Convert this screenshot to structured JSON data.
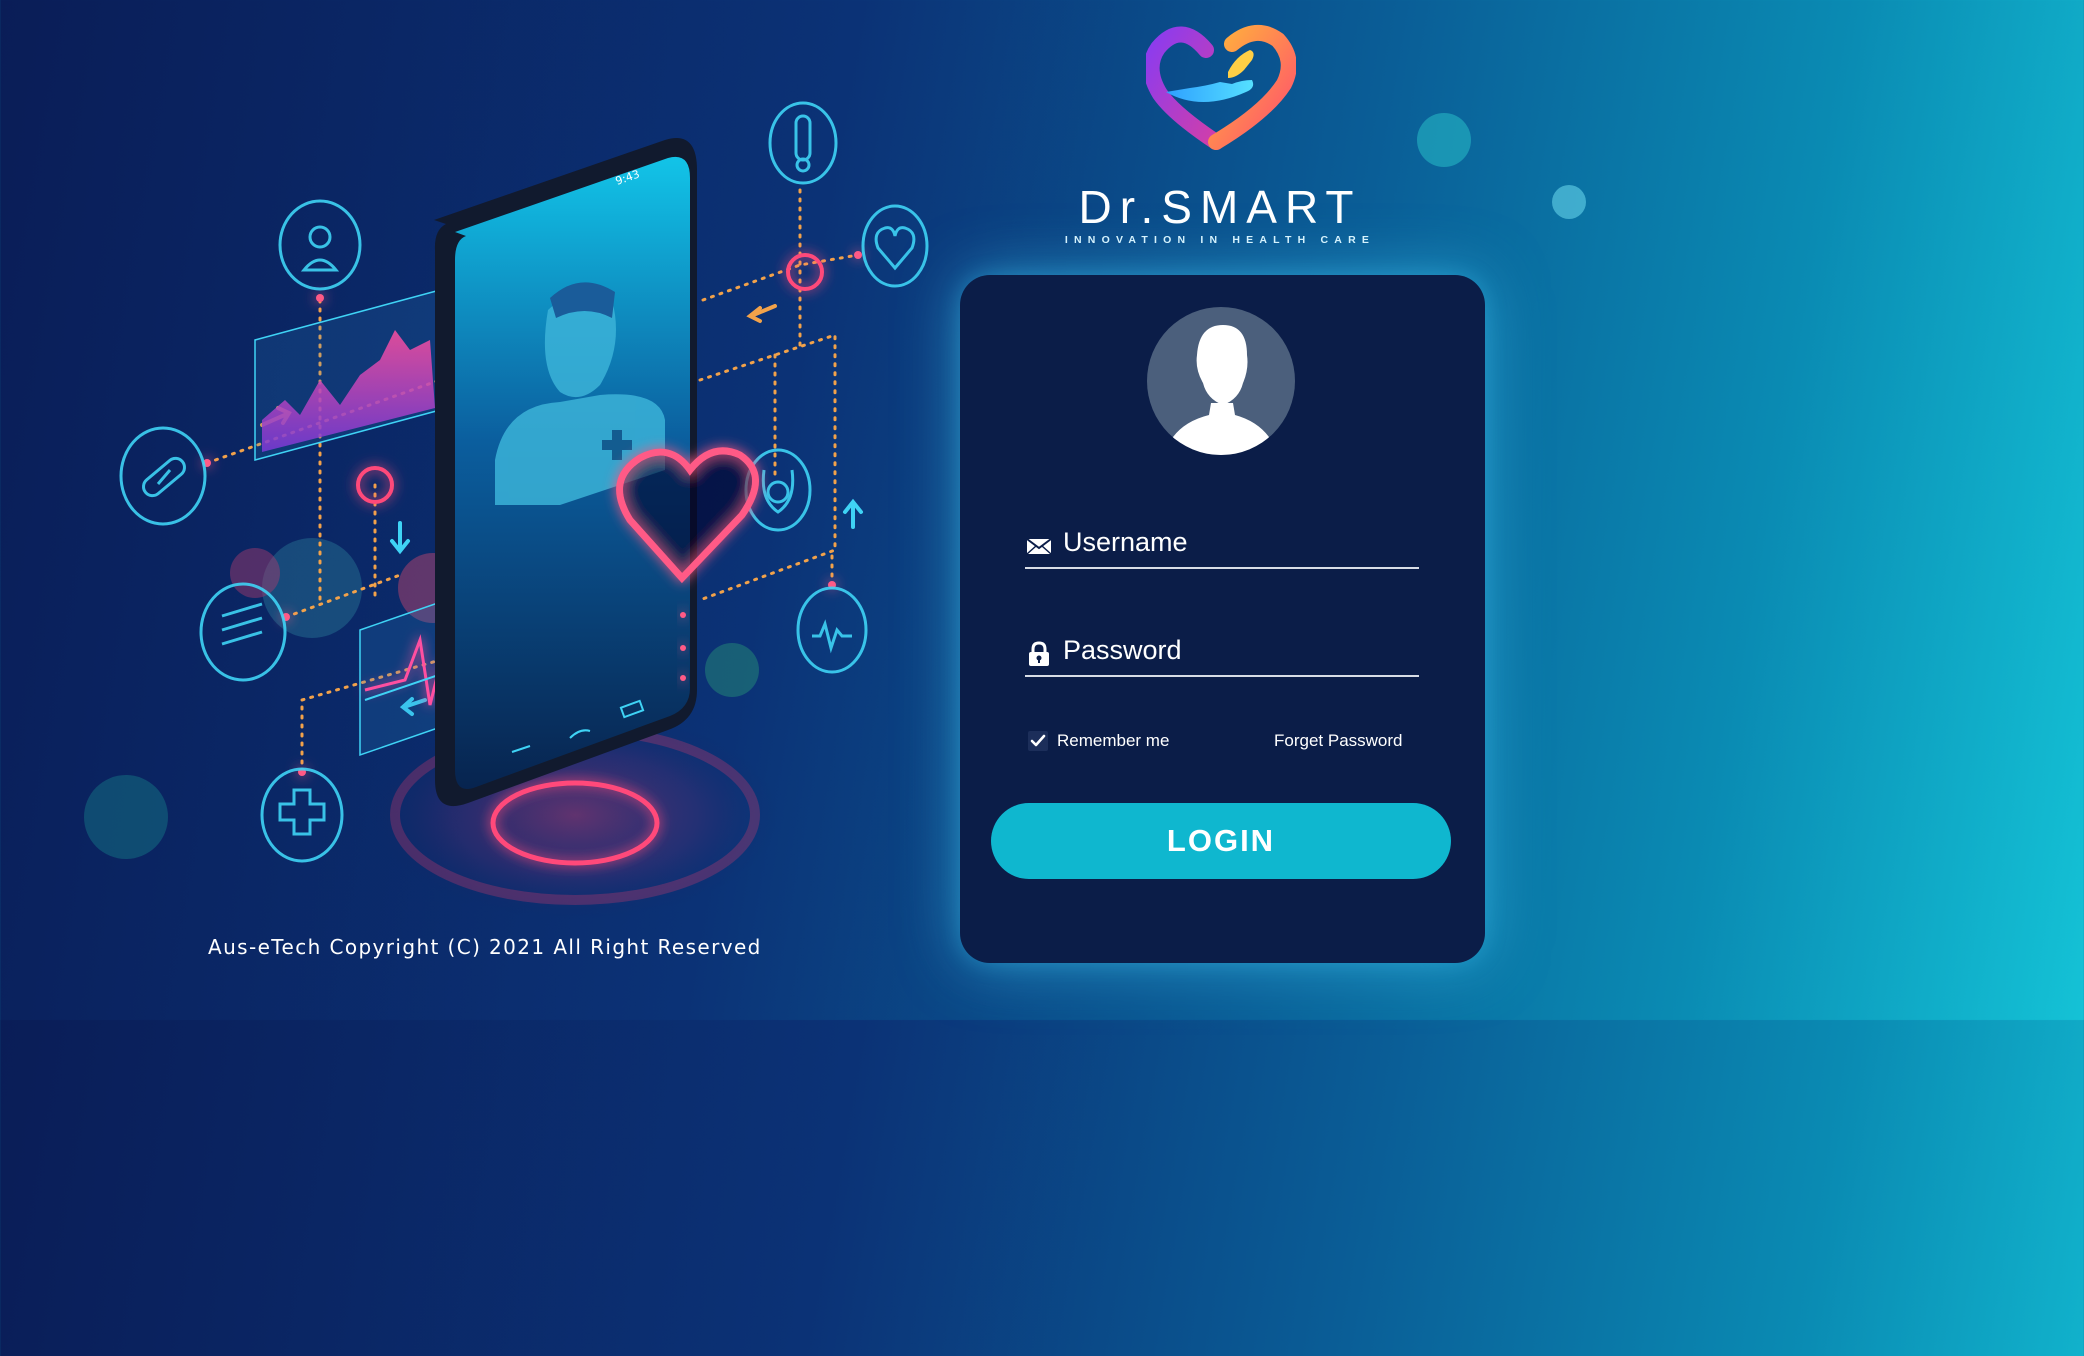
{
  "brand": {
    "name": "Dr.SMART",
    "tagline": "INNOVATION IN HEALTH CARE"
  },
  "illustration": {
    "phone_time": "9:43"
  },
  "login_form": {
    "username_label": "Username",
    "password_label": "Password",
    "remember_label": "Remember me",
    "remember_checked": true,
    "forgot_label": "Forget Password",
    "login_button": "LOGIN"
  },
  "footer": {
    "copyright": "Aus-eTech Copyright (C) 2021 All Right Reserved"
  },
  "colors": {
    "card_background": "#0b1d48",
    "button": "#0fb7cf",
    "accent_neon": "#ff3b6b",
    "line_cyan": "#3fd3f5",
    "dot_orange": "#f2a24a"
  },
  "icons": [
    "user-icon",
    "pill-icon",
    "list-icon",
    "medical-cross-icon",
    "thermometer-icon",
    "heart-icon",
    "stethoscope-icon",
    "ecg-icon",
    "envelope-icon",
    "lock-icon",
    "checkmark-icon"
  ]
}
